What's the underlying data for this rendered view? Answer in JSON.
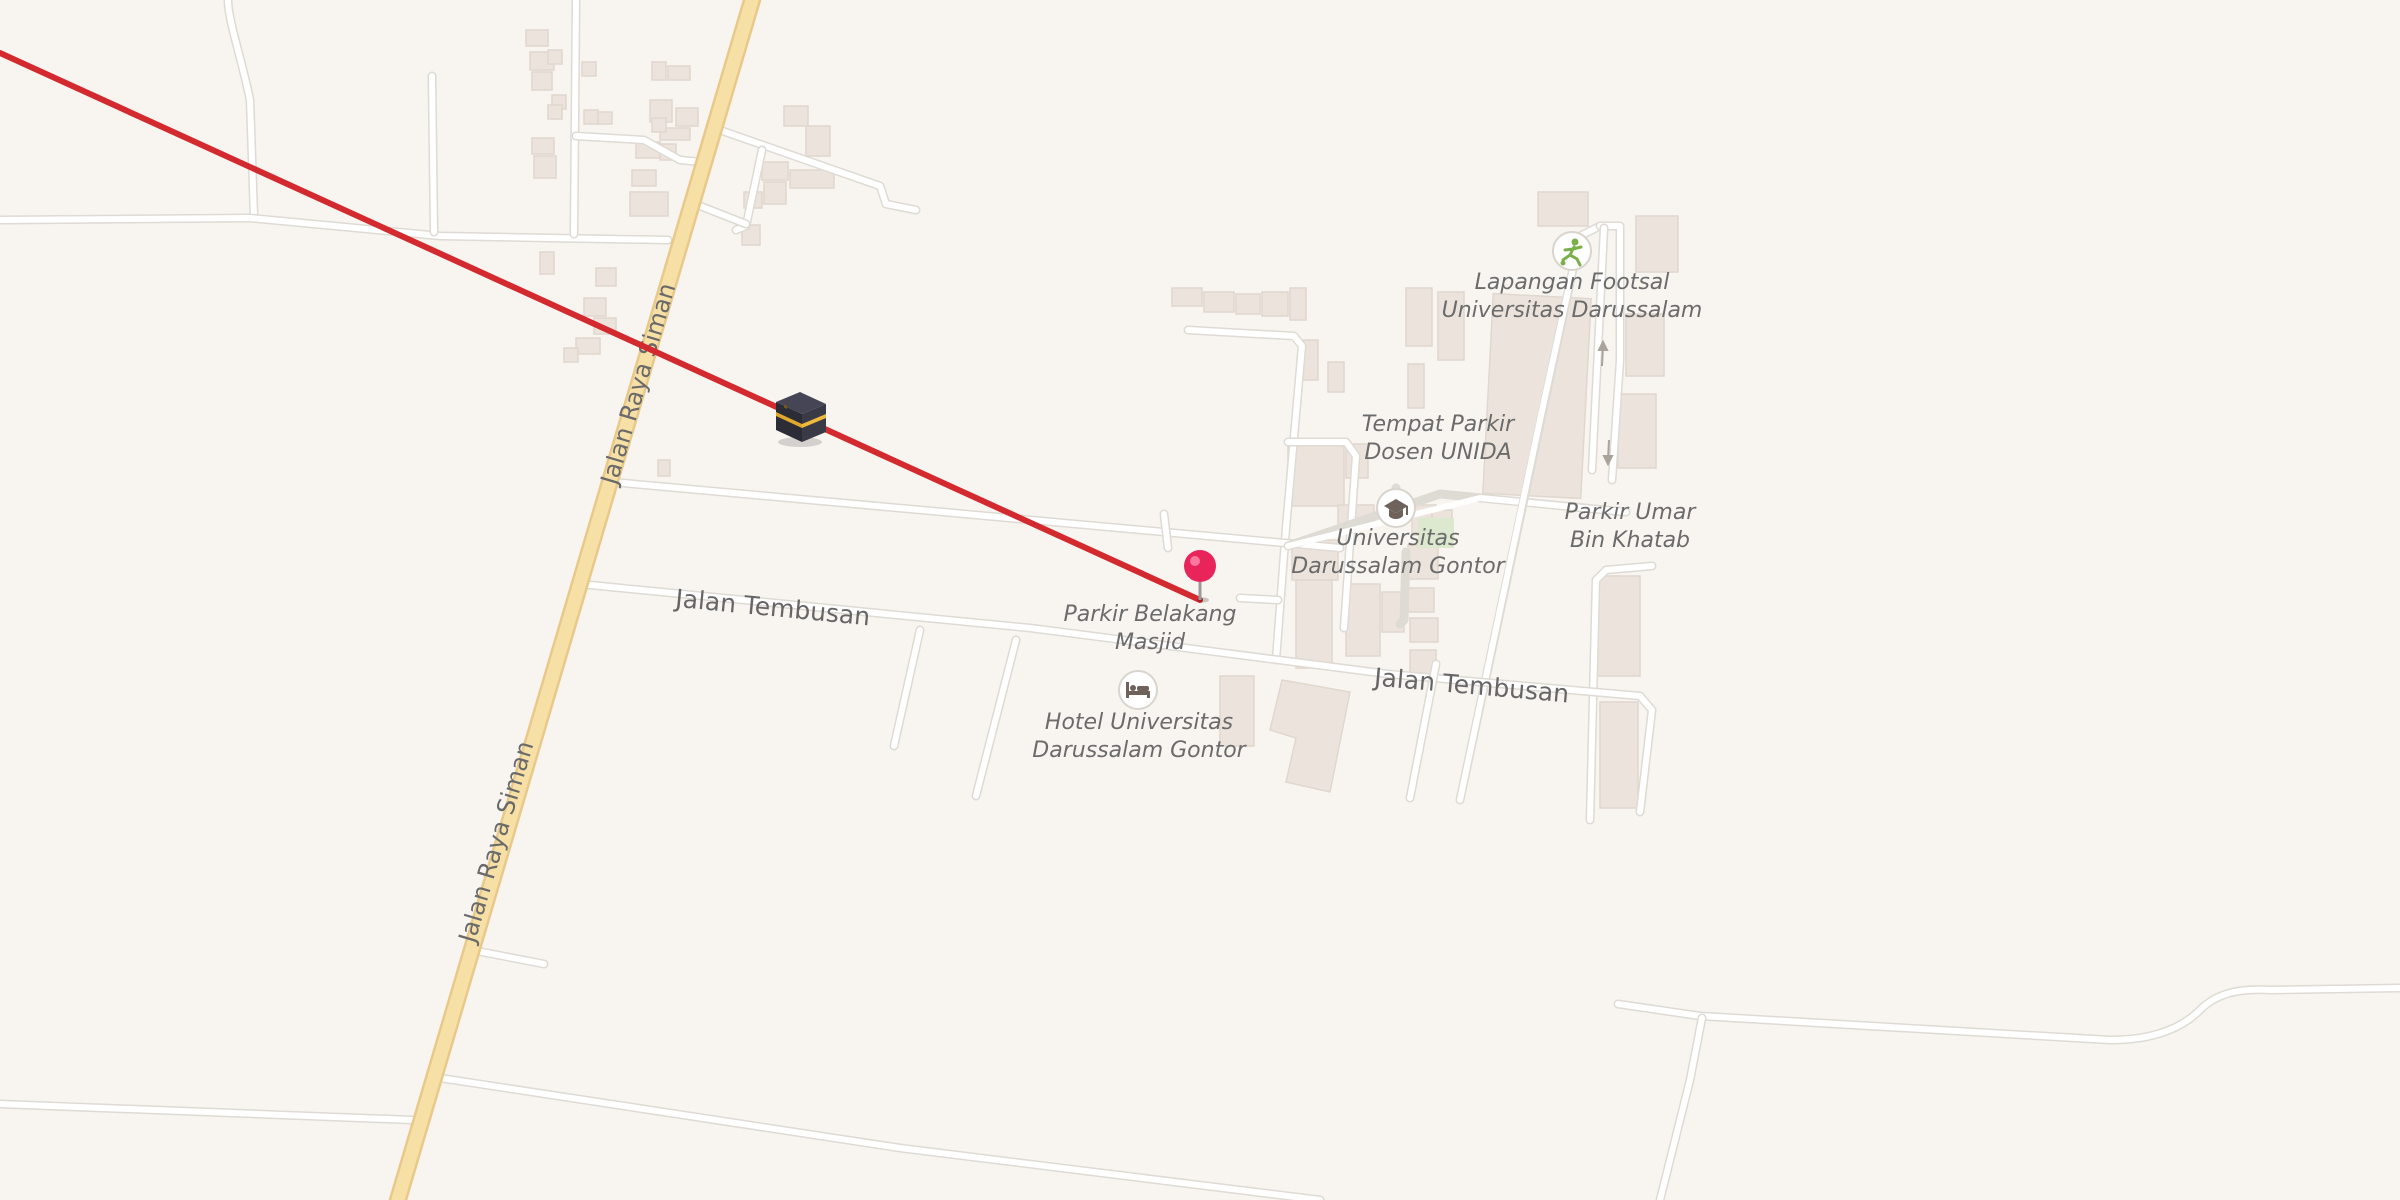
{
  "map": {
    "main_road": {
      "label_north": "Jalan Raya Siman",
      "label_south": "Jalan Raya Siman",
      "color": "#f7e0a6"
    },
    "roads": {
      "tembusan_west": "Jalan Tembusan",
      "tembusan_east": "Jalan Tembusan"
    },
    "pois": [
      {
        "id": "footsal",
        "icon": "soccer-icon",
        "line1": "Lapangan Footsal",
        "line2": "Universitas Darussalam",
        "icon_color": "#7ab04a"
      },
      {
        "id": "tempat-parkir",
        "line1": "Tempat Parkir",
        "line2": "Dosen UNIDA"
      },
      {
        "id": "universitas",
        "icon": "graduation-cap-icon",
        "line1": "Universitas",
        "line2": "Darussalam Gontor",
        "icon_color": "#7a6a5e"
      },
      {
        "id": "parkir-umar",
        "line1": "Parkir Umar",
        "line2": "Bin Khatab"
      },
      {
        "id": "parkir-belakang",
        "line1": "Parkir Belakang",
        "line2": "Masjid"
      },
      {
        "id": "hotel",
        "icon": "bed-icon",
        "line1": "Hotel Universitas",
        "line2": "Darussalam Gontor",
        "icon_color": "#7a6a5e"
      }
    ],
    "qibla_line_color": "#d32a2f",
    "pin_color": "#e8245a",
    "kaaba_icon": "kaaba-icon"
  }
}
